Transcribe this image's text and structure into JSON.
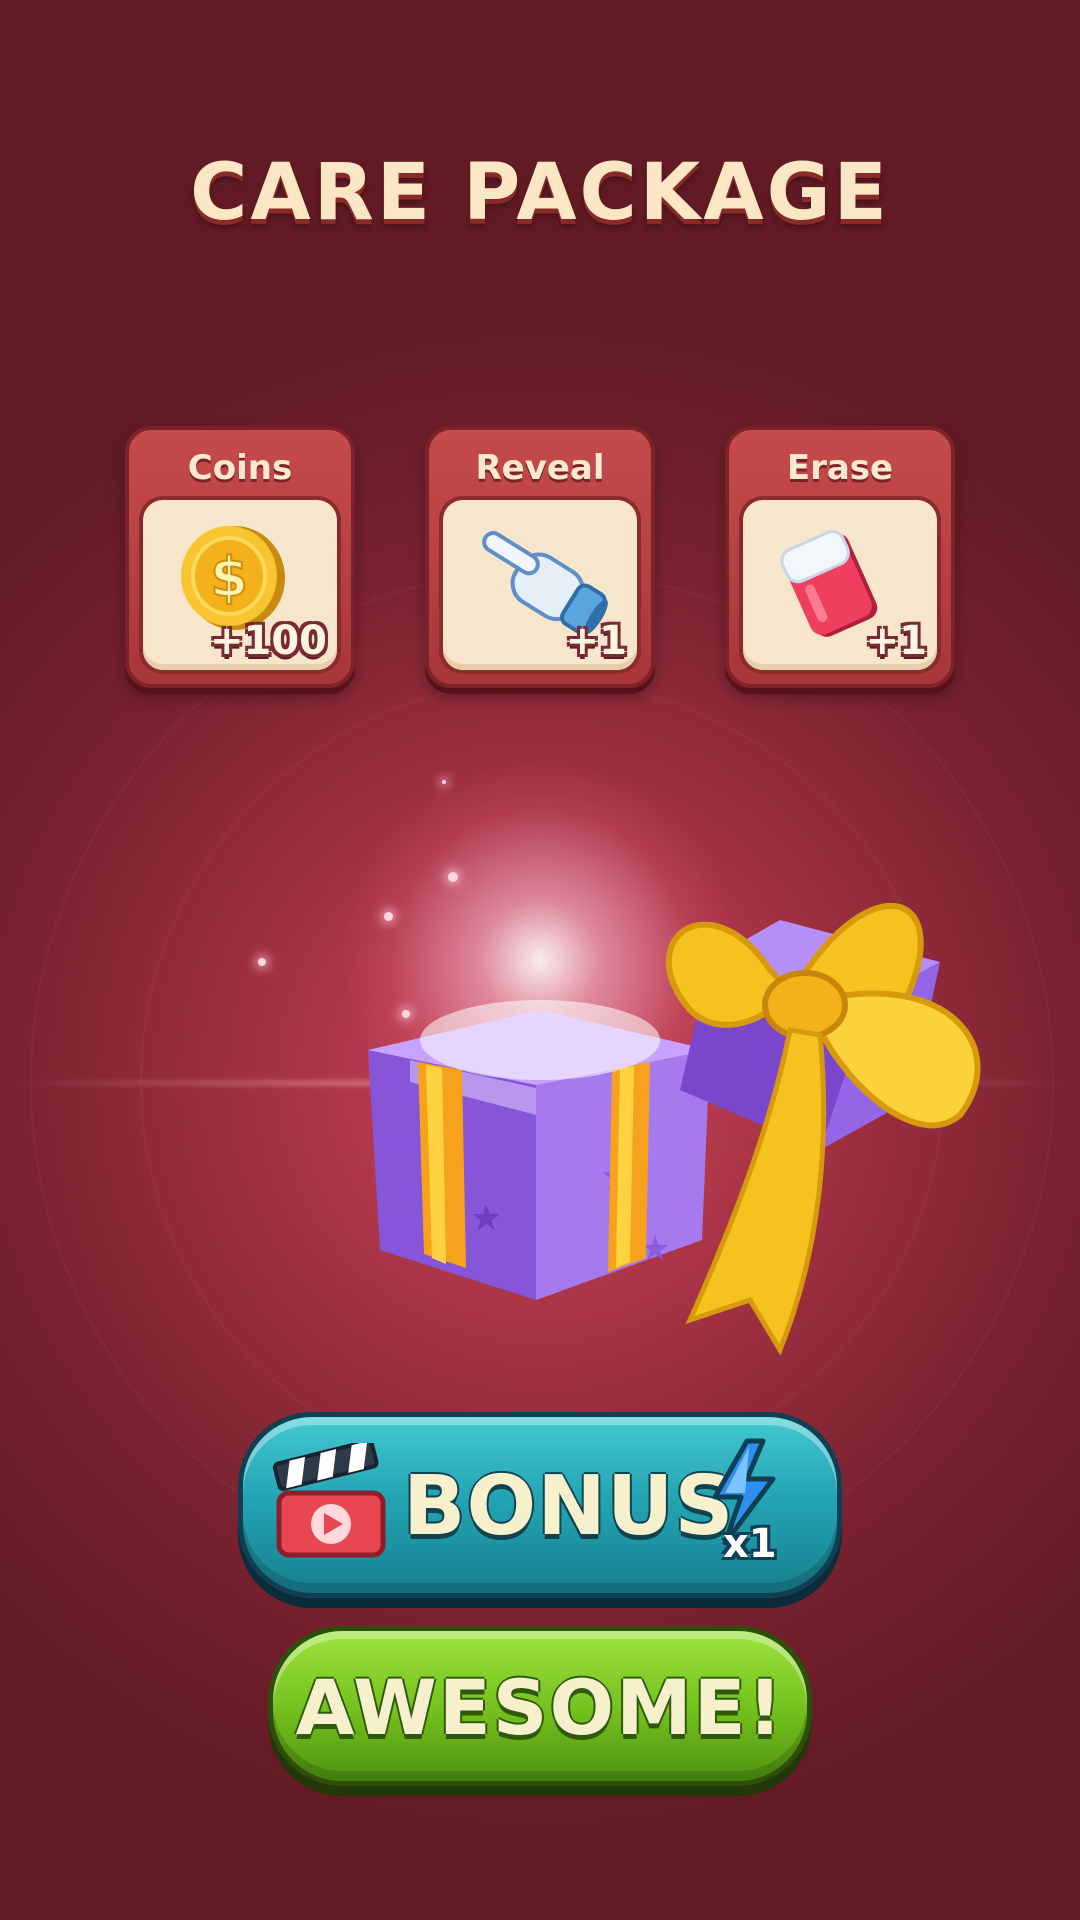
{
  "title": "CARE PACKAGE",
  "rewards": [
    {
      "label": "Coins",
      "amount": "+100",
      "icon": "coin-icon"
    },
    {
      "label": "Reveal",
      "amount": "+1",
      "icon": "pointing-glove-icon"
    },
    {
      "label": "Erase",
      "amount": "+1",
      "icon": "eraser-icon"
    }
  ],
  "bonus_button": {
    "label": "BONUS",
    "multiplier": "x1",
    "icon": "clapperboard-icon",
    "badge_icon": "lightning-bolt-icon"
  },
  "awesome_button": {
    "label": "AWESOME!"
  },
  "colors": {
    "background": "#621b24",
    "card": "#b33e42",
    "card_inner": "#f7e6cb",
    "bonus_button": "#24a5b4",
    "awesome_button": "#77c31f",
    "gift_box": "#8a5ae0",
    "ribbon": "#f6c21f"
  }
}
